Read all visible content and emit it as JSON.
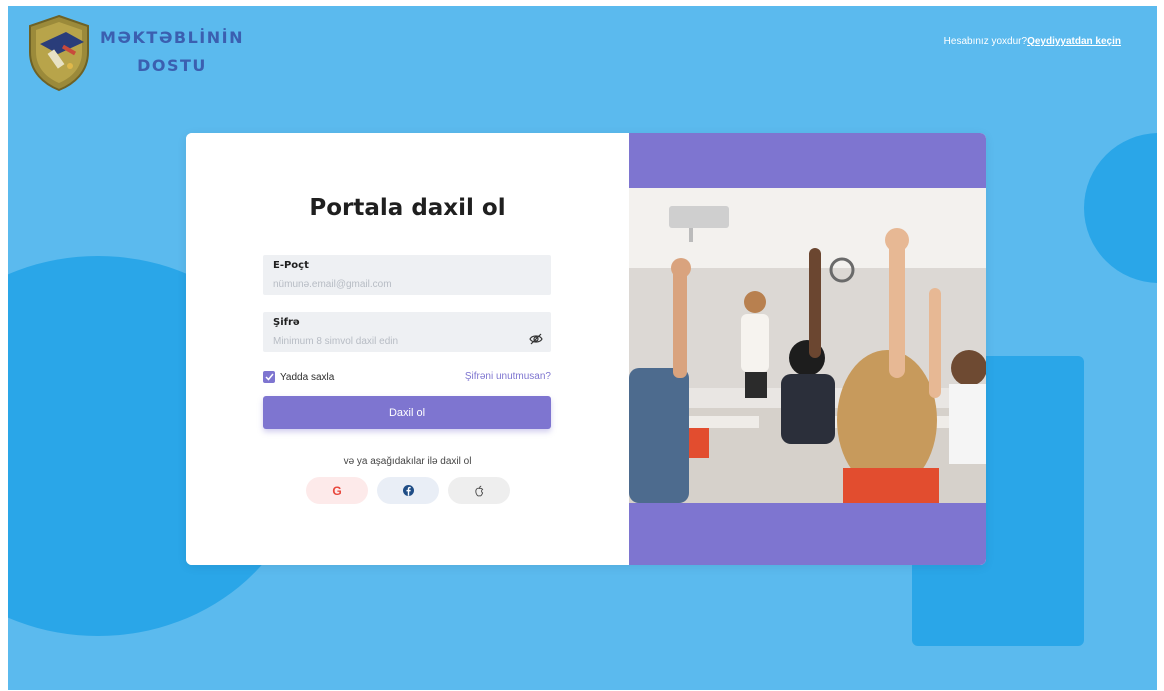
{
  "brand": {
    "line1": "MƏKTƏBLİNİN",
    "line2": "DOSTU"
  },
  "header": {
    "question": "Hesabınız yoxdur?",
    "signup_link": "Qeydiyyatdan keçin"
  },
  "login": {
    "title": "Portala daxil ol",
    "email": {
      "label": "E-Poçt",
      "placeholder": "nümunə.email@gmail.com"
    },
    "password": {
      "label": "Şifrə",
      "placeholder": "Minimum 8 simvol daxil edin"
    },
    "remember": {
      "label": "Yadda saxla",
      "checked": true
    },
    "forgot": "Şifrəni unutmusan?",
    "submit": "Daxil ol",
    "alt_text": "və ya aşağıdakılar ilə daxil ol",
    "social": [
      {
        "icon": "google-icon",
        "label": "G"
      },
      {
        "icon": "facebook-icon"
      },
      {
        "icon": "apple-icon"
      }
    ]
  },
  "colors": {
    "background": "#5bbaee",
    "accent_blue": "#2aa6e8",
    "purple": "#7e75d0",
    "google_red": "#e8463b",
    "facebook_blue": "#1f4d86"
  }
}
